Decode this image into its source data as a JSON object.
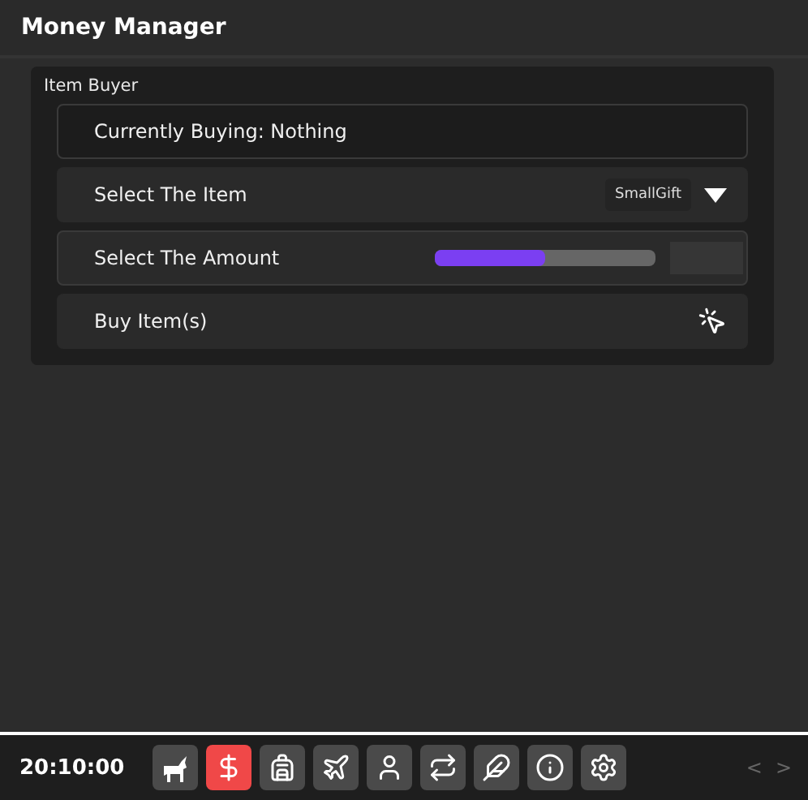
{
  "window": {
    "title": "Money Manager"
  },
  "section": {
    "title": "Item Buyer",
    "rows": [
      {
        "kind": "label",
        "label": "Currently Buying: Nothing"
      },
      {
        "kind": "dropdown",
        "label": "Select The Item",
        "value": "SmallGift"
      },
      {
        "kind": "slider",
        "label": "Select The Amount",
        "level": 0.5
      },
      {
        "kind": "button",
        "label": "Buy Item(s)"
      }
    ]
  },
  "taskbar": {
    "time": "20:10:00",
    "apps": [
      {
        "kind": "horse",
        "selected": false
      },
      {
        "kind": "dollar",
        "selected": true
      },
      {
        "kind": "backpack",
        "selected": false
      },
      {
        "kind": "plane",
        "selected": false
      },
      {
        "kind": "user",
        "selected": false
      },
      {
        "kind": "repeat",
        "selected": false
      },
      {
        "kind": "feather",
        "selected": false
      },
      {
        "kind": "info",
        "selected": false
      },
      {
        "kind": "settings",
        "selected": false
      }
    ],
    "prev": "<",
    "next": ">"
  }
}
